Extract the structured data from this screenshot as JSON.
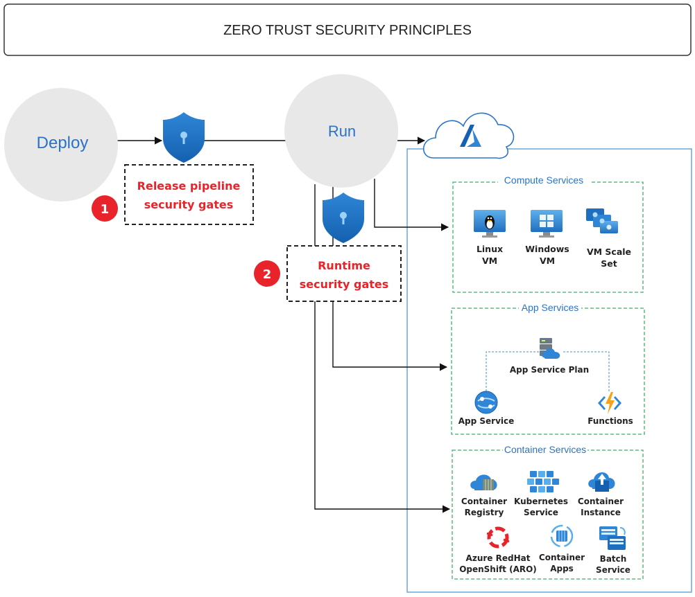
{
  "title": "ZERO TRUST SECURITY PRINCIPLES",
  "nodes": {
    "deploy": "Deploy",
    "run": "Run"
  },
  "gates": {
    "release": {
      "number": "1",
      "line1": "Release pipeline",
      "line2": "security gates"
    },
    "runtime": {
      "number": "2",
      "line1": "Runtime",
      "line2": "security gates"
    }
  },
  "groups": {
    "compute": {
      "title": "Compute Services",
      "items": [
        {
          "icon": "linux-vm-icon",
          "line1": "Linux",
          "line2": "VM"
        },
        {
          "icon": "windows-vm-icon",
          "line1": "Windows",
          "line2": "VM"
        },
        {
          "icon": "vm-scale-set-icon",
          "line1": "VM Scale",
          "line2": "Set"
        }
      ]
    },
    "app": {
      "title": "App Services",
      "plan": "App Service Plan",
      "service": "App Service",
      "functions": "Functions"
    },
    "container": {
      "title": "Container Services",
      "items": [
        {
          "icon": "container-registry-icon",
          "line1": "Container",
          "line2": "Registry"
        },
        {
          "icon": "kubernetes-service-icon",
          "line1": "Kubernetes",
          "line2": "Service"
        },
        {
          "icon": "container-instance-icon",
          "line1": "Container",
          "line2": "Instance"
        },
        {
          "icon": "azure-redhat-openshift-icon",
          "line1": "Azure RedHat",
          "line2": "OpenShift (ARO)"
        },
        {
          "icon": "container-apps-icon",
          "line1": "Container",
          "line2": "Apps"
        },
        {
          "icon": "batch-service-icon",
          "line1": "Batch",
          "line2": "Service"
        }
      ]
    }
  },
  "colors": {
    "accent_blue": "#2a73c7",
    "gate_red": "#e8232a",
    "group_border_green": "#3bb06b",
    "node_gray": "#e8e8e8",
    "azure_panel_border": "#4a90c8"
  }
}
